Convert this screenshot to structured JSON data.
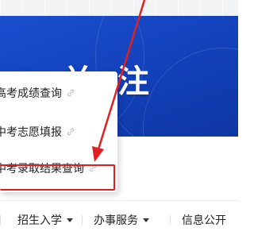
{
  "banner": {
    "title": "关注"
  },
  "dropdown": {
    "items": [
      {
        "label": "高考成绩查询",
        "icon": "link-icon"
      },
      {
        "label": "中考志愿填报",
        "icon": "link-icon"
      },
      {
        "label": "中考录取结果查询",
        "icon": "link-icon"
      }
    ],
    "highlighted_index": 2
  },
  "nav": {
    "items": [
      {
        "label": "招生入学"
      },
      {
        "label": "办事服务"
      },
      {
        "label": "信息公开"
      }
    ]
  },
  "colors": {
    "banner": "#1546c4",
    "highlight": "#e02020",
    "text": "#222222"
  }
}
